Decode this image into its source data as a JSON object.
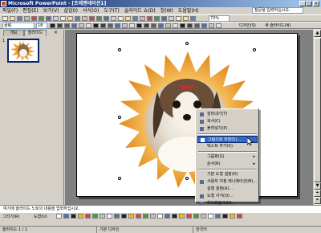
{
  "window": {
    "title": "Microsoft PowerPoint - [프레젠테이션1]",
    "min": "_",
    "max": "□",
    "close": "×"
  },
  "menu": [
    "파일(F)",
    "편집(E)",
    "보기(V)",
    "삽입(I)",
    "서식(O)",
    "도구(T)",
    "슬라이드 쇼(D)",
    "창(W)",
    "도움말(H)"
  ],
  "help_box": "질문을 입력하십시오.",
  "toolbar": {
    "zoom": "73%",
    "font": "굴림",
    "font_size": "18",
    "design_label": "디자인(S)",
    "new_slide_label": "새 슬라이드(N)"
  },
  "panel": {
    "tab_outline": "개요",
    "tab_slides": "슬라이드",
    "close": "×",
    "slide_number": "1"
  },
  "context_menu": {
    "items": [
      {
        "label": "잘라내기(T)",
        "icon": "scissors-icon"
      },
      {
        "label": "복사(C)",
        "icon": "copy-icon"
      },
      {
        "label": "붙여넣기(P)",
        "icon": "paste-icon"
      },
      {
        "label": "그림으로 저장(S)...",
        "icon": "save-image-icon",
        "highlighted": true
      },
      {
        "label": "텍스트 추가(X)",
        "icon": ""
      },
      {
        "label": "그룹화(G)",
        "icon": "",
        "submenu": true
      },
      {
        "label": "순서(R)",
        "icon": "",
        "submenu": true
      },
      {
        "label": "기본 도형 설정(D)",
        "icon": ""
      },
      {
        "label": "사용자 지정 애니메이션(M)...",
        "icon": "animation-icon"
      },
      {
        "label": "실행 설정(A)...",
        "icon": ""
      },
      {
        "label": "도형 서식(O)...",
        "icon": "format-shape-icon"
      },
      {
        "label": "하이퍼링크(H)...",
        "icon": "hyperlink-icon"
      }
    ]
  },
  "notes": "여기에 슬라이드 노트의 내용을 입력하십시오.",
  "drawbar": {
    "draw": "그리기(R)",
    "autoshape": "도형(U)"
  },
  "status": {
    "slide": "슬라이드 1 / 1",
    "design": "기본 디자인",
    "language": "한국어"
  },
  "colors": {
    "title_start": "#0a246a",
    "title_end": "#a6caf0",
    "starburst": "#f0a030",
    "highlight": "#316ac5"
  }
}
